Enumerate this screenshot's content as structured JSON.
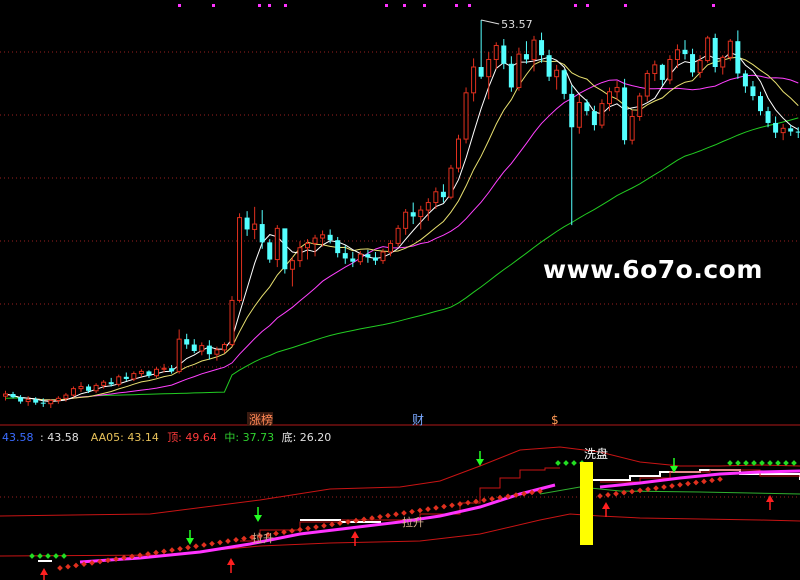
{
  "watermark": "www.6o7o.com",
  "main_panel": {
    "peak_label": "53.57",
    "price_range": [
      17.5,
      54.5
    ]
  },
  "markers": {
    "zhangting": "涨榜",
    "cai": "财",
    "dollar": "$"
  },
  "indicator_bar": [
    {
      "text": "43.58",
      "color": "#3a6cff"
    },
    {
      "text": ": 43.58",
      "color": "#e0e0e0"
    },
    {
      "text": "AA05: 43.14",
      "color": "#e7c15a"
    },
    {
      "text": "顶: 49.64",
      "color": "#ff3b3b"
    },
    {
      "text": "中: 37.73",
      "color": "#2fd12f"
    },
    {
      "text": "底: 26.20",
      "color": "#e0e0e0"
    }
  ],
  "sub_panel_labels": {
    "xipan": "洗盘",
    "lasheng_1": "拉升",
    "lasheng_2": "拉升"
  },
  "colors": {
    "up": "#e0301e",
    "down": "#54ffff",
    "ma5": "#ffffff",
    "ma10": "#e8e070",
    "ma20": "#ff40ff",
    "ma60": "#22cc22",
    "grid": "#9a1f1f",
    "band": "#c81414",
    "yellow": "#ffff00",
    "magenta": "#ff33ff"
  },
  "chart_data": {
    "type": "candlestick",
    "title": "",
    "candles": [
      [
        18.6,
        19.1,
        18.2,
        18.8
      ],
      [
        18.8,
        19.0,
        18.4,
        18.5
      ],
      [
        18.5,
        18.7,
        17.9,
        18.1
      ],
      [
        18.1,
        18.6,
        17.7,
        18.3
      ],
      [
        18.3,
        18.5,
        17.8,
        18.0
      ],
      [
        18.0,
        18.4,
        17.6,
        17.9
      ],
      [
        17.9,
        18.3,
        17.5,
        18.2
      ],
      [
        18.2,
        18.6,
        17.9,
        18.4
      ],
      [
        18.4,
        18.9,
        18.1,
        18.7
      ],
      [
        18.7,
        19.5,
        18.5,
        19.3
      ],
      [
        19.3,
        19.9,
        19.0,
        19.5
      ],
      [
        19.5,
        19.7,
        18.9,
        19.1
      ],
      [
        19.1,
        19.8,
        18.9,
        19.6
      ],
      [
        19.6,
        20.1,
        19.3,
        19.9
      ],
      [
        19.9,
        20.3,
        19.5,
        19.7
      ],
      [
        19.7,
        20.6,
        19.5,
        20.4
      ],
      [
        20.4,
        20.8,
        20.0,
        20.2
      ],
      [
        20.2,
        20.9,
        20.0,
        20.7
      ],
      [
        20.7,
        21.1,
        20.4,
        20.9
      ],
      [
        20.9,
        21.0,
        20.3,
        20.5
      ],
      [
        20.5,
        21.3,
        20.3,
        21.1
      ],
      [
        21.1,
        21.6,
        20.8,
        21.2
      ],
      [
        21.2,
        21.5,
        20.7,
        20.9
      ],
      [
        20.9,
        24.8,
        20.7,
        23.9
      ],
      [
        23.9,
        24.4,
        23.0,
        23.4
      ],
      [
        23.4,
        23.9,
        22.6,
        22.8
      ],
      [
        22.8,
        23.6,
        22.4,
        23.3
      ],
      [
        23.3,
        23.8,
        22.0,
        22.5
      ],
      [
        22.5,
        23.2,
        21.9,
        22.9
      ],
      [
        22.9,
        23.6,
        22.6,
        23.4
      ],
      [
        23.4,
        27.9,
        23.2,
        27.5
      ],
      [
        27.5,
        35.6,
        27.3,
        35.2
      ],
      [
        35.2,
        35.8,
        33.5,
        34.1
      ],
      [
        34.1,
        36.2,
        33.2,
        34.6
      ],
      [
        34.6,
        35.9,
        32.3,
        32.9
      ],
      [
        32.9,
        33.2,
        31.0,
        31.3
      ],
      [
        31.3,
        34.5,
        30.6,
        34.2
      ],
      [
        34.2,
        33.8,
        30.0,
        30.4
      ],
      [
        30.4,
        31.5,
        28.8,
        31.2
      ],
      [
        31.2,
        33.0,
        30.6,
        32.4
      ],
      [
        32.4,
        33.2,
        31.3,
        32.8
      ],
      [
        32.8,
        33.6,
        31.6,
        33.3
      ],
      [
        33.3,
        34.0,
        32.5,
        33.6
      ],
      [
        33.6,
        34.1,
        32.8,
        33.1
      ],
      [
        33.1,
        33.4,
        31.5,
        31.9
      ],
      [
        31.9,
        32.6,
        30.9,
        31.4
      ],
      [
        31.4,
        32.0,
        30.6,
        31.1
      ],
      [
        31.1,
        32.1,
        30.8,
        31.8
      ],
      [
        31.8,
        32.2,
        31.0,
        31.5
      ],
      [
        31.5,
        32.0,
        30.8,
        31.2
      ],
      [
        31.2,
        32.3,
        30.9,
        32.0
      ],
      [
        32.0,
        33.1,
        31.6,
        32.8
      ],
      [
        32.8,
        34.5,
        32.5,
        34.2
      ],
      [
        34.2,
        36.0,
        33.6,
        35.7
      ],
      [
        35.7,
        36.6,
        34.6,
        35.3
      ],
      [
        35.3,
        36.3,
        34.1,
        35.9
      ],
      [
        35.9,
        37.0,
        34.9,
        36.6
      ],
      [
        36.6,
        38.0,
        36.0,
        37.6
      ],
      [
        37.6,
        38.3,
        36.6,
        37.1
      ],
      [
        37.1,
        40.1,
        36.9,
        39.8
      ],
      [
        39.8,
        42.9,
        39.4,
        42.5
      ],
      [
        42.5,
        47.3,
        42.1,
        46.8
      ],
      [
        46.8,
        50.0,
        46.0,
        49.2
      ],
      [
        49.2,
        53.57,
        48.1,
        48.3
      ],
      [
        48.3,
        50.6,
        46.2,
        49.9
      ],
      [
        49.9,
        51.5,
        49.0,
        51.2
      ],
      [
        51.2,
        51.8,
        49.0,
        49.5
      ],
      [
        49.5,
        50.2,
        46.9,
        47.3
      ],
      [
        47.3,
        51.0,
        47.0,
        50.4
      ],
      [
        50.4,
        51.6,
        49.5,
        49.9
      ],
      [
        49.9,
        52.1,
        48.8,
        51.7
      ],
      [
        51.7,
        52.4,
        49.6,
        50.3
      ],
      [
        50.3,
        50.8,
        47.9,
        48.3
      ],
      [
        48.3,
        49.4,
        47.1,
        48.9
      ],
      [
        48.9,
        49.0,
        46.2,
        46.7
      ],
      [
        46.7,
        47.5,
        34.5,
        43.6
      ],
      [
        43.6,
        46.6,
        43.0,
        45.9
      ],
      [
        45.9,
        46.2,
        44.7,
        45.1
      ],
      [
        45.1,
        45.6,
        43.3,
        43.8
      ],
      [
        43.8,
        46.2,
        43.5,
        45.8
      ],
      [
        45.8,
        47.3,
        45.1,
        46.9
      ],
      [
        46.9,
        47.9,
        46.1,
        47.3
      ],
      [
        47.3,
        48.1,
        42.0,
        42.4
      ],
      [
        42.4,
        45.2,
        42.0,
        44.6
      ],
      [
        44.6,
        46.8,
        44.2,
        46.5
      ],
      [
        46.5,
        48.9,
        46.0,
        48.6
      ],
      [
        48.6,
        49.8,
        47.9,
        49.4
      ],
      [
        49.4,
        49.5,
        47.5,
        48.0
      ],
      [
        48.0,
        50.3,
        47.6,
        49.9
      ],
      [
        49.9,
        51.3,
        49.1,
        50.8
      ],
      [
        50.8,
        51.7,
        49.9,
        50.4
      ],
      [
        50.4,
        50.9,
        48.3,
        48.7
      ],
      [
        48.7,
        50.3,
        48.2,
        49.8
      ],
      [
        49.8,
        52.1,
        49.6,
        51.9
      ],
      [
        51.9,
        52.3,
        48.7,
        49.2
      ],
      [
        49.2,
        50.3,
        48.5,
        50.1
      ],
      [
        50.1,
        51.8,
        49.8,
        51.6
      ],
      [
        51.6,
        52.6,
        48.1,
        48.6
      ],
      [
        48.6,
        48.9,
        46.8,
        47.4
      ],
      [
        47.4,
        47.9,
        46.1,
        46.5
      ],
      [
        46.5,
        46.9,
        44.7,
        45.1
      ],
      [
        45.1,
        45.5,
        43.6,
        44.0
      ],
      [
        44.0,
        44.6,
        42.6,
        43.1
      ],
      [
        43.1,
        43.9,
        42.4,
        43.5
      ],
      [
        43.5,
        43.8,
        42.8,
        43.2
      ],
      [
        43.2,
        43.6,
        42.6,
        43.1
      ]
    ]
  }
}
